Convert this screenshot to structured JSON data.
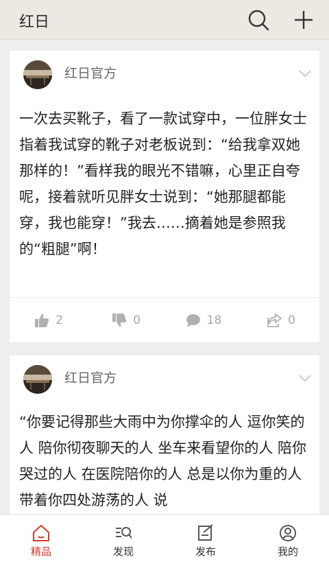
{
  "header": {
    "title": "红日"
  },
  "posts": [
    {
      "author": "红日官方",
      "text": "一次去买靴子，看了一款试穿中，一位胖女士指着我试穿的靴子对老板说到：“给我拿双她那样的！”看样我的眼光不错嘛，心里正自夸呢，接着就听见胖女士说到：“她那腿都能穿，我也能穿！”我去……摘着她是参照我的“粗腿”啊！",
      "likes": "2",
      "dislikes": "0",
      "comments": "18",
      "shares": "0"
    },
    {
      "author": "红日官方",
      "text": "“你要记得那些大雨中为你撑伞的人 逗你笑的人 陪你彻夜聊天的人 坐车来看望你的人 陪你哭过的人 在医院陪你的人 总是以你为重的人 带着你四处游荡的人 说"
    }
  ],
  "tabs": [
    {
      "label": "精品",
      "icon": "home-icon",
      "active": true
    },
    {
      "label": "发现",
      "icon": "discover-icon"
    },
    {
      "label": "发布",
      "icon": "publish-icon"
    },
    {
      "label": "我的",
      "icon": "profile-icon"
    }
  ],
  "colors": {
    "accent": "#d93a2b",
    "header_bg": "#ece9e2",
    "page_bg": "#efeeec"
  }
}
